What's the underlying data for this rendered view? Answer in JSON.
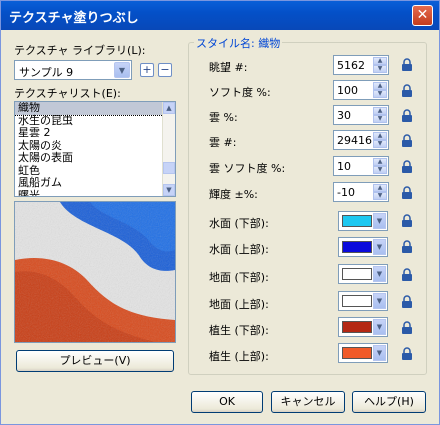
{
  "window": {
    "title": "テクスチャ塗りつぶし",
    "close_symbol": "✕"
  },
  "library": {
    "label": "テクスチャ ライブラリ(L):",
    "selected": "サンプル 9"
  },
  "texture_list": {
    "label": "テクスチャリスト(E):",
    "items": [
      "織物",
      "水生の昆虫",
      "星雲 2",
      "太陽の炎",
      "太陽の表面",
      "虹色",
      "風船ガム",
      "曙光"
    ],
    "selected_index": 0
  },
  "preview_button": "プレビュー(V)",
  "style": {
    "title": "スタイル名: 織物",
    "params": [
      {
        "label": "眺望 #:",
        "value": "5162"
      },
      {
        "label": "ソフト度 %:",
        "value": "100"
      },
      {
        "label": "雲 %:",
        "value": "30"
      },
      {
        "label": "雲 #:",
        "value": "29416"
      },
      {
        "label": "雲 ソフト度 %:",
        "value": "10"
      },
      {
        "label": "輝度 ±%:",
        "value": "-10"
      }
    ],
    "colors": [
      {
        "label": "水面 (下部):",
        "color": "#1ec8f0"
      },
      {
        "label": "水面 (上部):",
        "color": "#0a0adc"
      },
      {
        "label": "地面 (下部):",
        "color": "#ffffff"
      },
      {
        "label": "地面 (上部):",
        "color": "#ffffff"
      },
      {
        "label": "植生 (下部):",
        "color": "#b42814"
      },
      {
        "label": "植生 (上部):",
        "color": "#f05a28"
      }
    ]
  },
  "buttons": {
    "ok": "OK",
    "cancel": "キャンセル",
    "help": "ヘルプ(H)"
  },
  "icons": {
    "lock": "lock-icon",
    "add": "plus-icon",
    "remove": "minus-icon"
  }
}
